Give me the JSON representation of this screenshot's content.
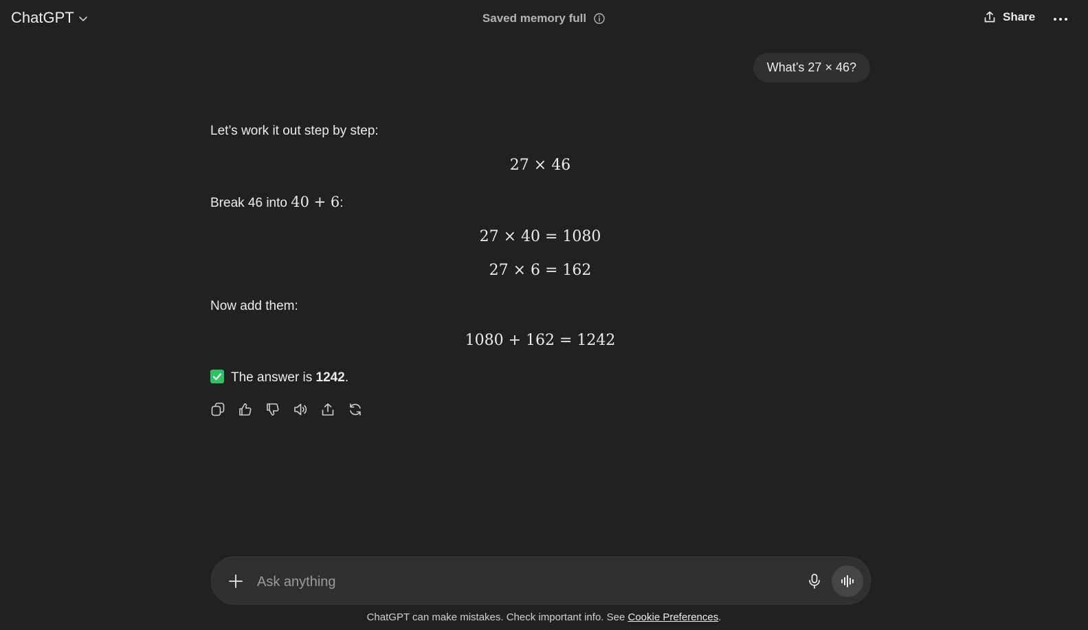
{
  "header": {
    "model_name": "ChatGPT",
    "memory_status": "Saved memory full",
    "share_label": "Share"
  },
  "conversation": {
    "user_message": "What’s 27 × 46?",
    "assistant": {
      "intro": "Let’s work it out step by step:",
      "eq_main": "27 × 46",
      "break_text": "Break 46 into ",
      "break_math": "40 + 6",
      "break_suffix": ":",
      "eq_step1": "27 × 40 = 1080",
      "eq_step2": "27 × 6 = 162",
      "add_text": "Now add them:",
      "eq_sum": "1080 + 162 = 1242",
      "answer_prefix": "The answer is ",
      "answer_value": "1242",
      "answer_suffix": "."
    }
  },
  "composer": {
    "placeholder": "Ask anything"
  },
  "footer": {
    "disclaimer": "ChatGPT can make mistakes. Check important info. See ",
    "link_label": "Cookie Preferences",
    "suffix": "."
  },
  "colors": {
    "background": "#212121",
    "bubble": "#303030",
    "check_green": "#2ec166"
  }
}
